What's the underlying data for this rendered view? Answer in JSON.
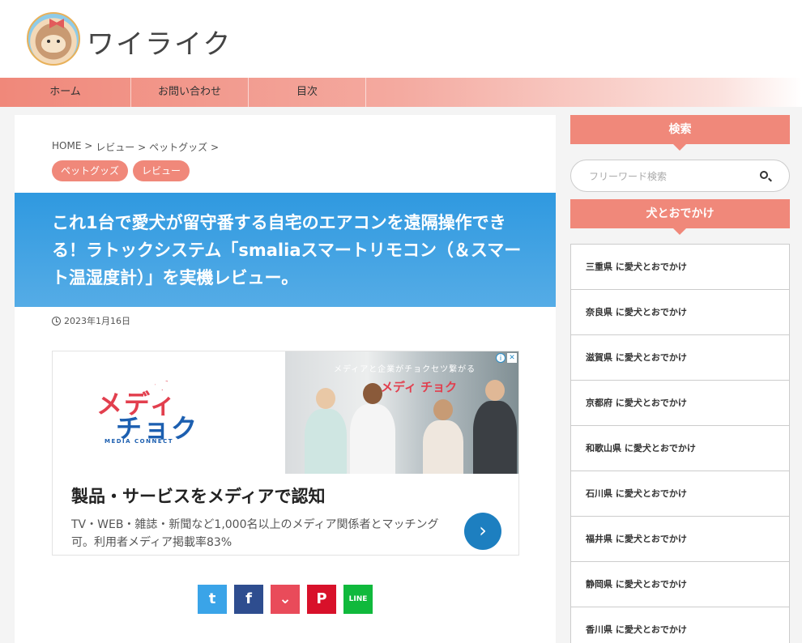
{
  "header": {
    "site_title": "ワイライク"
  },
  "nav": {
    "items": [
      "ホーム",
      "お問い合わせ",
      "目次"
    ]
  },
  "article": {
    "breadcrumb": [
      "HOME >",
      "レビュー >",
      "ペットグッズ >"
    ],
    "tags": [
      "ペットグッズ",
      "レビュー"
    ],
    "title": "これ1台で愛犬が留守番する自宅のエアコンを遠隔操作できる！ラトックシステム「smaliaスマートリモコン（＆スマート温湿度計）」を実機レビュー。",
    "date": "2023年1月16日"
  },
  "ad": {
    "brand_line1": "メディ",
    "brand_line2": "チョク",
    "brand_sub": "MEDIA CONNECT",
    "photo_caption": "メディアと企業がチョクセツ繋がる",
    "photo_brand": "メディ チョク",
    "info_symbol": "i",
    "close_symbol": "✕",
    "headline": "製品・サービスをメディアで認知",
    "description": "TV・WEB・雑誌・新聞など1,000名以上のメディア関係者とマッチング可。利用者メディア掲載率83%",
    "arrow": "›"
  },
  "share": {
    "twitter": "t",
    "facebook": "f",
    "pocket": "⌄",
    "pinterest": "P",
    "line": "LINE"
  },
  "sidebar": {
    "search_heading": "検索",
    "search_placeholder": "フリーワード検索",
    "category_heading": "犬とおでかけ",
    "items": [
      "三重県 に愛犬とおでかけ",
      "奈良県 に愛犬とおでかけ",
      "滋賀県 に愛犬とおでかけ",
      "京都府 に愛犬とおでかけ",
      "和歌山県 に愛犬とおでかけ",
      "石川県 に愛犬とおでかけ",
      "福井県 に愛犬とおでかけ",
      "静岡県 に愛犬とおでかけ",
      "香川県 に愛犬とおでかけ"
    ]
  },
  "colors": {
    "accent": "#f0887a",
    "title_band": "#2f99e0"
  }
}
